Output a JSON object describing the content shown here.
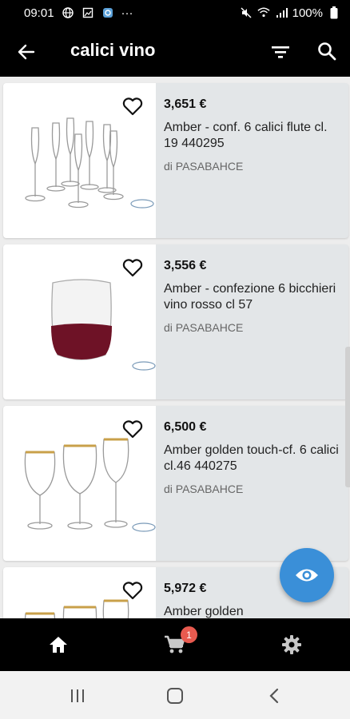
{
  "status_bar": {
    "time": "09:01",
    "dots": "···",
    "battery": "100%"
  },
  "app_bar": {
    "title": "calici vino",
    "back_icon": "arrow-back-icon",
    "filter_icon": "filter-icon",
    "search_icon": "search-icon"
  },
  "products": [
    {
      "price": "3,651 €",
      "name": "Amber -  conf. 6 calici  flute cl. 19   440295",
      "brand": "di PASABAHCE"
    },
    {
      "price": "3,556 €",
      "name": "Amber - confezione 6 bicchieri vino rosso cl 57",
      "brand": "di PASABAHCE"
    },
    {
      "price": "6,500 €",
      "name": "Amber golden touch-cf. 6 calici cl.46  440275",
      "brand": "di PASABAHCE"
    },
    {
      "price": "5,972 €",
      "name": "Amber golden",
      "brand": ""
    }
  ],
  "bottom_nav": {
    "home_icon": "home-icon",
    "cart_icon": "cart-icon",
    "cart_badge": "1",
    "settings_icon": "settings-icon"
  },
  "fab": {
    "icon": "eye-icon"
  },
  "colors": {
    "accent": "#3a8fd8",
    "badge": "#e85a4f",
    "card_bg": "#e3e6e8",
    "bar_bg": "#000000"
  }
}
